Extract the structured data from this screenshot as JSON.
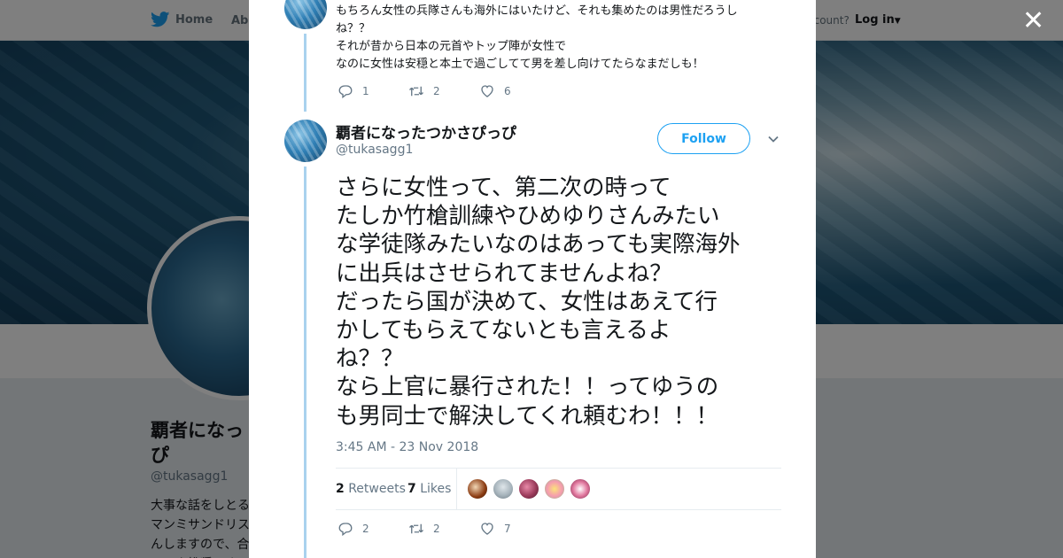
{
  "nav": {
    "home_label": "Home",
    "about_label": "Abo",
    "account_prompt": "ccount?",
    "login_label": "Log in"
  },
  "profile": {
    "name": "覇者になっ\nぴ",
    "handle": "@tukasagg1",
    "bio": "大事な話をしとる\nマンミサンドリス\nんしますので、合\nロック推奨です"
  },
  "previous_tweet": {
    "lines": [
      "もちろん女性の兵隊さんも海外にはいたけど、それも集めたのは男性だろうし",
      "ね？？",
      "それが昔から日本の元首やトップ陣が女性で",
      "なのに女性は安穏と本土で過ごしてて男を差し向けてたらなまだしも！"
    ],
    "replies": "1",
    "retweets": "2",
    "likes": "6"
  },
  "tweet": {
    "display_name": "覇者になったつかさぴっぴ",
    "handle": "@tukasagg1",
    "follow_label": "Follow",
    "body": "さらに女性って、第二次の時って\nたしか竹槍訓練やひめゆりさんみたい\nな学徒隊みたいなのはあっても実際海外\nに出兵はさせられてませんよね？\nだったら国が決めて、女性はあえて行\nかしてもらえてないとも言えるよ\nね？？\nなら上官に暴行された！！ってゆうの\nも男同士で解決してくれ頼むわ！！！",
    "timestamp": "3:45 AM - 23 Nov 2018",
    "retweet_count": "2",
    "retweet_label": "Retweets",
    "like_count": "7",
    "like_label": "Likes",
    "replies": "2",
    "retweets": "2",
    "likes": "7"
  },
  "colors": {
    "accent": "#1da1f2",
    "thread_line": "#a9d2ee",
    "text": "#14171a",
    "muted": "#657786"
  },
  "icons": [
    "twitter-bird-icon",
    "close-icon",
    "reply-icon",
    "retweet-icon",
    "heart-icon",
    "chevron-down-icon"
  ]
}
